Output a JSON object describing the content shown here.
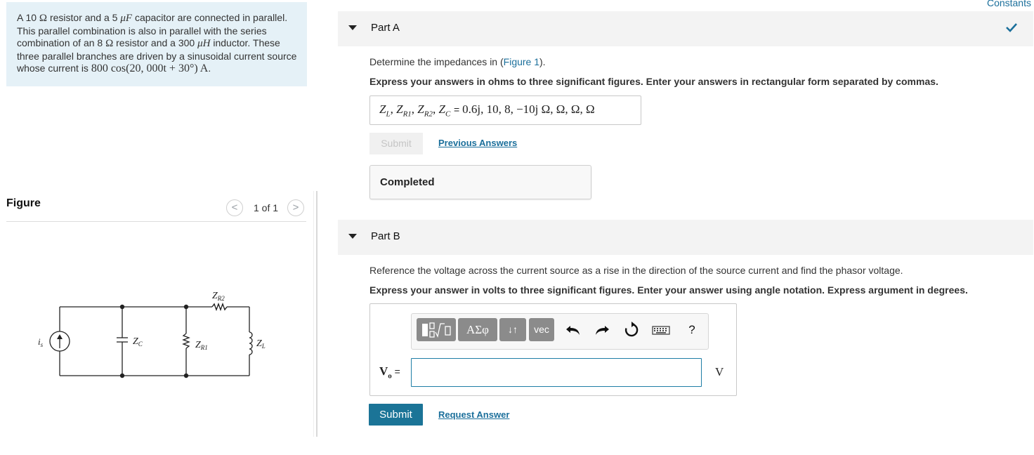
{
  "problem": {
    "line1_a": "A 10",
    "ohm": "Ω",
    "line1_b": " resistor and a 5",
    "micro_f": "μF",
    "line1_c": " capacitor are connected in parallel. This parallel combination is also in parallel with the series combination of an 8",
    "line1_d": " resistor and a 300",
    "micro_h": "μH",
    "line1_e": " inductor. These three parallel branches are driven by a sinusoidal current source whose current is",
    "current_expr": "800 cos(20, 000t + 30°) A",
    "period": "."
  },
  "figure": {
    "title": "Figure",
    "prev": "<",
    "count": "1 of 1",
    "next": ">",
    "labels": {
      "source": "i",
      "source_sub": "s",
      "zc": "Z",
      "zc_sub": "C",
      "zr1": "Z",
      "zr1_sub": "R1",
      "zr2": "Z",
      "zr2_sub": "R2",
      "zl": "Z",
      "zl_sub": "L"
    }
  },
  "constants_link": "Constants",
  "partA": {
    "title": "Part A",
    "instruction_a": "Determine the impedances in (",
    "figure_link": "Figure 1",
    "instruction_b": ").",
    "express": "Express your answers in ohms to three significant figures. Enter your answers in rectangular form separated by commas.",
    "answer_vars": "Z",
    "answer_subs": [
      "L",
      "R1",
      "R2",
      "C"
    ],
    "answer_eq": " = ",
    "answer_value": "0.6j, 10, 8, −10j  Ω, Ω, Ω, Ω",
    "submit_label": "Submit",
    "previous_answers": "Previous Answers",
    "status": "Completed"
  },
  "partB": {
    "title": "Part B",
    "instruction": "Reference the voltage across the current source as a rise in the direction of the source current and find the phasor voltage.",
    "express": "Express your answer in volts to three significant figures. Enter your answer using angle notation. Express argument in degrees.",
    "toolbar": {
      "greek": "ΑΣφ",
      "sort": "↓↑",
      "vec": "vec",
      "help": "?"
    },
    "var_label": "V",
    "var_sub": "o",
    "eq": " =",
    "input_value": "",
    "unit": "V",
    "submit_label": "Submit",
    "request_answer": "Request Answer"
  },
  "colors": {
    "accent": "#1b7497",
    "link": "#1b6f9b",
    "problem_bg": "#e5f1f7",
    "check": "#1b6f9b"
  }
}
